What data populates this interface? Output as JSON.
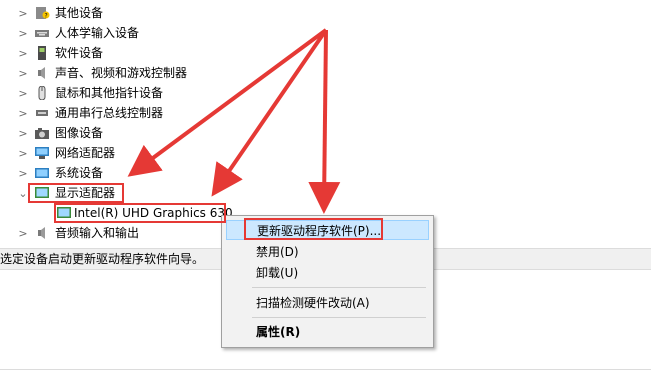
{
  "device_tree": {
    "categories": [
      {
        "label": "其他设备",
        "icon": "other-devices-icon"
      },
      {
        "label": "人体学输入设备",
        "icon": "hid-icon"
      },
      {
        "label": "软件设备",
        "icon": "software-device-icon"
      },
      {
        "label": "声音、视频和游戏控制器",
        "icon": "speaker-icon"
      },
      {
        "label": "鼠标和其他指针设备",
        "icon": "mouse-icon"
      },
      {
        "label": "通用串行总线控制器",
        "icon": "usb-icon"
      },
      {
        "label": "图像设备",
        "icon": "camera-icon"
      },
      {
        "label": "网络适配器",
        "icon": "network-adapter-icon"
      },
      {
        "label": "系统设备",
        "icon": "system-device-icon"
      },
      {
        "label": "显示适配器",
        "icon": "display-adapter-icon"
      }
    ],
    "display_child": {
      "label": "Intel(R) UHD Graphics 630",
      "icon": "display-adapter-icon"
    },
    "last_category": {
      "label": "音频输入和输出",
      "icon": "speaker-icon"
    }
  },
  "status_bar": {
    "text": "选定设备启动更新驱动程序软件向导。"
  },
  "context_menu": {
    "items": [
      {
        "label": "更新驱动程序软件(P)..."
      },
      {
        "label": "禁用(D)"
      },
      {
        "label": "卸载(U)"
      },
      {
        "label": "扫描检测硬件改动(A)"
      },
      {
        "label": "属性(R)"
      }
    ]
  },
  "colors": {
    "annotation_red": "#e53935",
    "menu_highlight": "#cce8ff",
    "menu_background": "#f2f2f2"
  }
}
